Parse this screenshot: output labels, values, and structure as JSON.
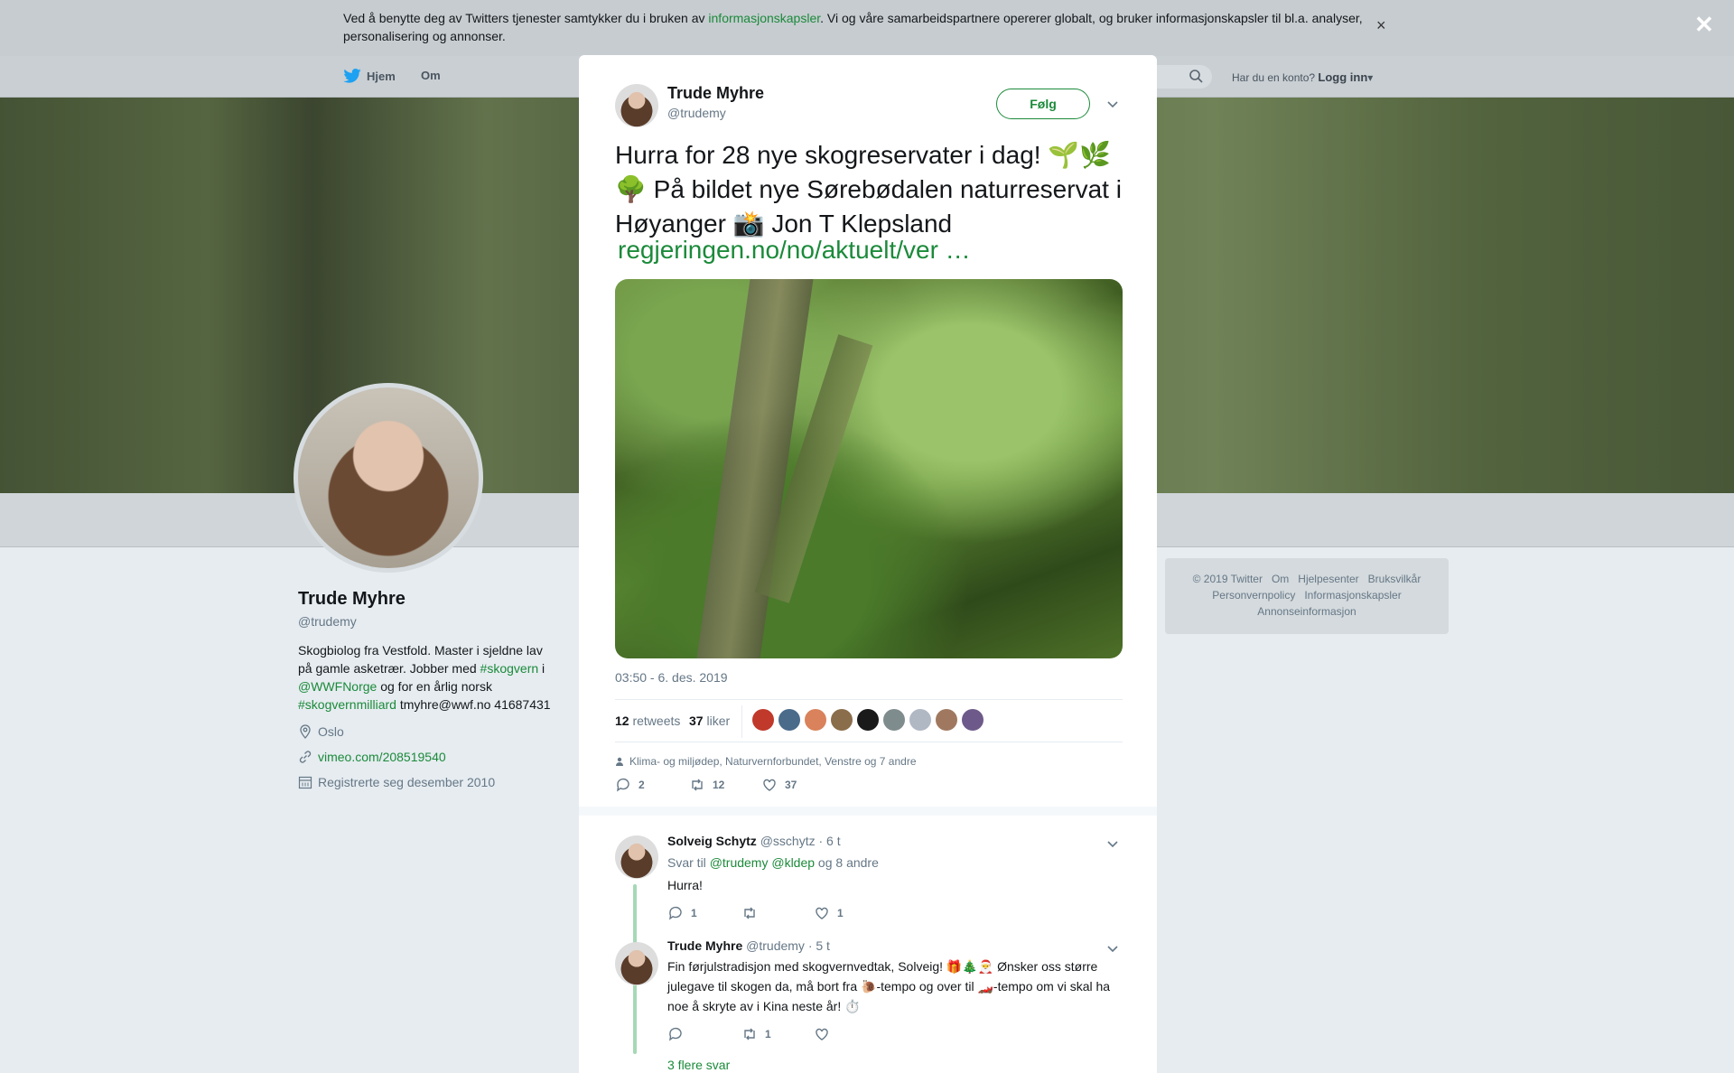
{
  "cookie_bar": {
    "text_before": "Ved å benytte deg av Twitters tjenester samtykker du i bruken av ",
    "link": "informasjonskapsler",
    "text_after": ". Vi og våre samarbeidspartnere opererer globalt, og bruker informasjonskapsler til bl.a. analyser, personalisering og annonser.",
    "close_label": "×"
  },
  "nav": {
    "home": "Hjem",
    "about": "Om",
    "login_prompt": "Har du en konto?",
    "login": "Logg inn",
    "login_caret": "▾"
  },
  "profile": {
    "name": "Trude Myhre",
    "handle": "@trudemy",
    "bio_1": "Skogbiolog fra Vestfold. Master i sjeldne lav på gamle asketrær. Jobber med ",
    "bio_tag1": "#skogvern",
    "bio_2": " i ",
    "bio_mention": "@WWFNorge",
    "bio_3": " og for en årlig norsk ",
    "bio_tag2": "#skogvernmilliard",
    "bio_4": " tmyhre@wwf.no 41687431",
    "location": "Oslo",
    "website": "vimeo.com/208519540",
    "joined": "Registrerte seg desember 2010"
  },
  "footer": {
    "row1": [
      "© 2019 Twitter",
      "Om",
      "Hjelpesenter",
      "Bruksvilkår"
    ],
    "row2": [
      "Personvernpolicy",
      "Informasjonskapsler"
    ],
    "row3": [
      "Annonseinformasjon"
    ]
  },
  "modal_close": "✕",
  "tweet": {
    "name": "Trude Myhre",
    "handle": "@trudemy",
    "follow": "Følg",
    "text": "Hurra for 28 nye skogreservater i dag! 🌱🌿🌳 På bildet nye Sørebødalen naturreservat i Høyanger 📸 Jon T Klepsland",
    "link": "regjeringen.no/no/aktuelt/ver …",
    "time": "03:50 - 6. des. 2019",
    "retweets_count": "12",
    "retweets_label": "retweets",
    "likes_count": "37",
    "likes_label": "liker",
    "face_colors": [
      "#c0392b",
      "#4a6b8a",
      "#d9825b",
      "#8a6d4a",
      "#1a1a1a",
      "#7f8c8d",
      "#b0b8c4",
      "#a07860",
      "#6d5a8a"
    ],
    "context": "Klima- og miljødep, Naturvernforbundet, Venstre og 7 andre",
    "replies": "2",
    "rt": "12",
    "likes": "37"
  },
  "reply1": {
    "name": "Solveig Schytz",
    "handle": "@sschytz",
    "time": "· 6 t",
    "reply_to_label": "Svar til",
    "mentions": "@trudemy @kldep",
    "others": " og 8 andre",
    "text": "Hurra!",
    "replies": "1",
    "likes": "1"
  },
  "reply2": {
    "name": "Trude Myhre",
    "handle": "@trudemy",
    "time": "· 5 t",
    "text": "Fin førjulstradisjon med skogvernvedtak, Solveig! 🎁🎄🎅 Ønsker oss større julegave til skogen da, må bort fra 🐌-tempo og over til 🏎️-tempo om vi skal ha noe å skryte av i Kina neste år! ⏱️",
    "rt": "1",
    "more": "3 flere svar"
  }
}
